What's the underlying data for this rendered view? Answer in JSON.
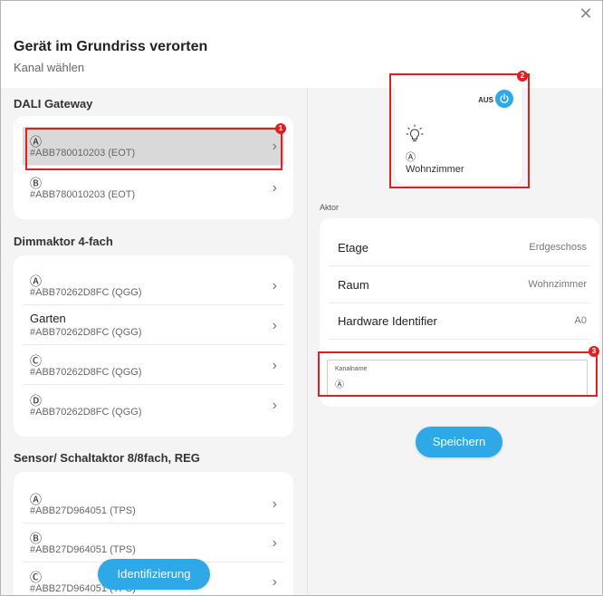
{
  "dialog": {
    "title": "Gerät im Grundriss verorten",
    "subtitle": "Kanal wählen",
    "close_icon": "close-icon"
  },
  "groups": [
    {
      "title": "DALI Gateway",
      "items": [
        {
          "name": "Ⓐ",
          "id": "#ABB780010203 (EOT)",
          "selected": true
        },
        {
          "name": "Ⓑ",
          "id": "#ABB780010203 (EOT)",
          "selected": false
        }
      ]
    },
    {
      "title": "Dimmaktor 4-fach",
      "items": [
        {
          "name": "Ⓐ",
          "id": "#ABB70262D8FC (QGG)"
        },
        {
          "name": "Garten",
          "id": "#ABB70262D8FC (QGG)"
        },
        {
          "name": "Ⓒ",
          "id": "#ABB70262D8FC (QGG)"
        },
        {
          "name": "Ⓓ",
          "id": "#ABB70262D8FC (QGG)"
        }
      ]
    },
    {
      "title": "Sensor/ Schaltaktor 8/8fach, REG",
      "items": [
        {
          "name": "Ⓐ",
          "id": "#ABB27D964051 (TPS)"
        },
        {
          "name": "Ⓑ",
          "id": "#ABB27D964051 (TPS)"
        },
        {
          "name": "Ⓒ",
          "id": "#ABB27D964051 (TPS)"
        }
      ]
    }
  ],
  "chevron_icon": "chevron-right-icon",
  "tile": {
    "state": "AUS",
    "channel": "Ⓐ",
    "room": "Wohnzimmer",
    "icons": [
      "power-icon",
      "light-bulb-icon"
    ]
  },
  "aktor": {
    "section_label": "Aktor",
    "rows": [
      {
        "key": "Etage",
        "value": "Erdgeschoss"
      },
      {
        "key": "Raum",
        "value": "Wohnzimmer"
      },
      {
        "key": "Hardware Identifier",
        "value": "A0"
      }
    ],
    "channel_name_label": "Kanalname",
    "channel_name_value": "Ⓐ"
  },
  "buttons": {
    "save": "Speichern",
    "identify": "Identifizierung"
  },
  "annotations": [
    "1",
    "2",
    "3"
  ],
  "colors": {
    "accent": "#2ea8e6",
    "highlight": "#e02020",
    "panel": "#f4f4f4"
  }
}
